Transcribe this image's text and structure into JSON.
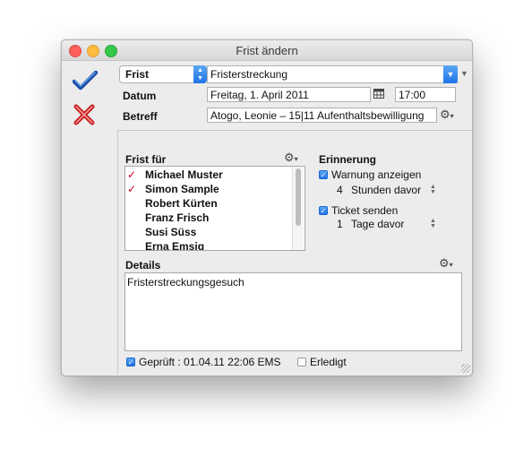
{
  "window": {
    "title": "Frist ändern"
  },
  "actions": {
    "confirm_icon": "checkmark-icon",
    "cancel_icon": "x-icon"
  },
  "type_popup": {
    "value": "Frist"
  },
  "type_combo": {
    "value": "Fristerstreckung"
  },
  "labels": {
    "datum": "Datum",
    "betreff": "Betreff"
  },
  "datum": {
    "date": "Freitag, 1. April 2011",
    "time": "17:00"
  },
  "betreff": {
    "value": "Atogo, Leonie – 15|11 Aufenthaltsbewilligung"
  },
  "frist_fuer": {
    "label": "Frist für",
    "items": [
      {
        "name": "Michael Muster",
        "checked": true
      },
      {
        "name": "Simon Sample",
        "checked": true
      },
      {
        "name": "Robert Kürten",
        "checked": false
      },
      {
        "name": "Franz Frisch",
        "checked": false
      },
      {
        "name": "Susi Süss",
        "checked": false
      },
      {
        "name": "Erna Emsig",
        "checked": false
      }
    ],
    "check_glyph": "✓"
  },
  "erinnerung": {
    "label": "Erinnerung",
    "warnung": {
      "label": "Warnung anzeigen",
      "checked": true,
      "amount": "4",
      "unit": "Stunden davor"
    },
    "ticket": {
      "label": "Ticket senden",
      "checked": true,
      "amount": "1",
      "unit": "Tage davor"
    }
  },
  "details": {
    "label": "Details",
    "text": "Fristerstreckungsgesuch"
  },
  "footer": {
    "geprueft": "Geprüft : 01.04.11 22:06 EMS",
    "geprueft_checked": true,
    "erledigt": "Erledigt",
    "erledigt_checked": false
  }
}
